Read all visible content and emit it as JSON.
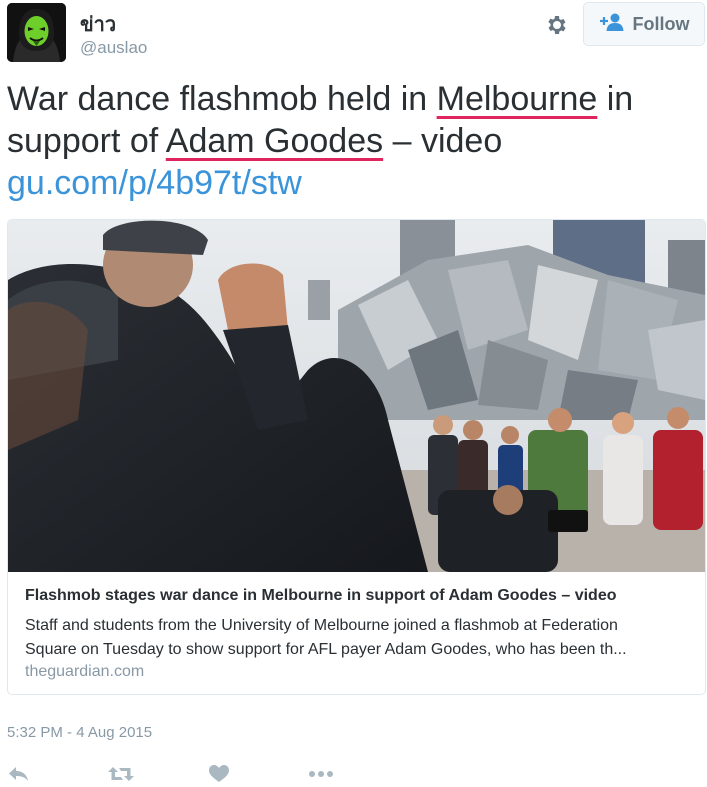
{
  "tweet": {
    "display_name": "ข่าว",
    "handle": "@auslao",
    "follow_label": "Follow",
    "text": {
      "p1": "War dance flashmob held in ",
      "link1": "Melbourne",
      "p2": " in support of ",
      "link2": "Adam Goodes",
      "p3": " – video",
      "url": "gu.com/p/4b97t/stw"
    },
    "card": {
      "title": "Flashmob stages war dance in Melbourne in support of Adam Goodes – video",
      "description_line1": "Staff and students from the University of Melbourne joined a flashmob at Federation",
      "description_line2": "Square on Tuesday to show support for AFL payer Adam Goodes, who has been th...",
      "domain": "theguardian.com"
    },
    "timestamp": "5:32 PM - 4 Aug 2015"
  },
  "icons": {
    "settings": "gear-icon",
    "follow": "person-plus-icon",
    "reply": "reply-icon",
    "retweet": "retweet-icon",
    "like": "heart-icon",
    "more": "more-dots-icon"
  },
  "colors": {
    "link": "#3b94d9",
    "muted": "#8899a6",
    "underline": "#e0245e",
    "text": "#292f33"
  }
}
